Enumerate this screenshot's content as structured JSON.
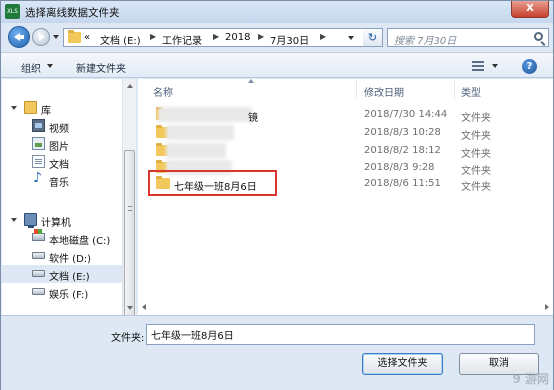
{
  "window": {
    "title": "选择离线数据文件夹",
    "close_label": "X"
  },
  "nav": {
    "address": {
      "overflow": "«",
      "crumbs": [
        "文档 (E:)",
        "工作记录",
        "2018",
        "7月30日"
      ]
    },
    "search": {
      "placeholder": "搜索 7月30日"
    }
  },
  "toolbar": {
    "organize": "组织",
    "new_folder": "新建文件夹",
    "help": "?"
  },
  "sidebar": {
    "libraries": {
      "label": "库",
      "items": [
        {
          "label": "视频",
          "icon": "video-icon"
        },
        {
          "label": "图片",
          "icon": "picture-icon"
        },
        {
          "label": "文档",
          "icon": "document-icon"
        },
        {
          "label": "音乐",
          "icon": "music-icon"
        }
      ]
    },
    "computer": {
      "label": "计算机",
      "drives": [
        {
          "label": "本地磁盘 (C:)",
          "icon": "system-drive-icon"
        },
        {
          "label": "软件 (D:)",
          "icon": "drive-icon"
        },
        {
          "label": "文档 (E:)",
          "icon": "drive-icon",
          "selected": true
        },
        {
          "label": "娱乐 (F:)",
          "icon": "drive-icon"
        }
      ]
    }
  },
  "filelist": {
    "columns": {
      "name": "名称",
      "date": "修改日期",
      "type": "类型"
    },
    "rows": [
      {
        "name": "镜",
        "date": "2018/7/30 14:44",
        "type": "文件夹",
        "obscured": true
      },
      {
        "name": "",
        "date": "2018/8/3 10:28",
        "type": "文件夹",
        "obscured": true
      },
      {
        "name": "",
        "date": "2018/8/2 18:12",
        "type": "文件夹",
        "obscured": true
      },
      {
        "name": "",
        "date": "2018/8/3 9:28",
        "type": "文件夹",
        "obscured": true
      },
      {
        "name": "七年级一班8月6日",
        "date": "2018/8/6 11:51",
        "type": "文件夹",
        "highlighted": true
      }
    ]
  },
  "bottom": {
    "folder_label": "文件夹:",
    "folder_value": "七年级一班8月6日",
    "select_button": "选择文件夹",
    "cancel_button": "取消"
  },
  "watermark": "9 游网",
  "colors": {
    "highlight": "#d8362f",
    "accent": "#1e5fae",
    "selection": "#dde8f4"
  }
}
